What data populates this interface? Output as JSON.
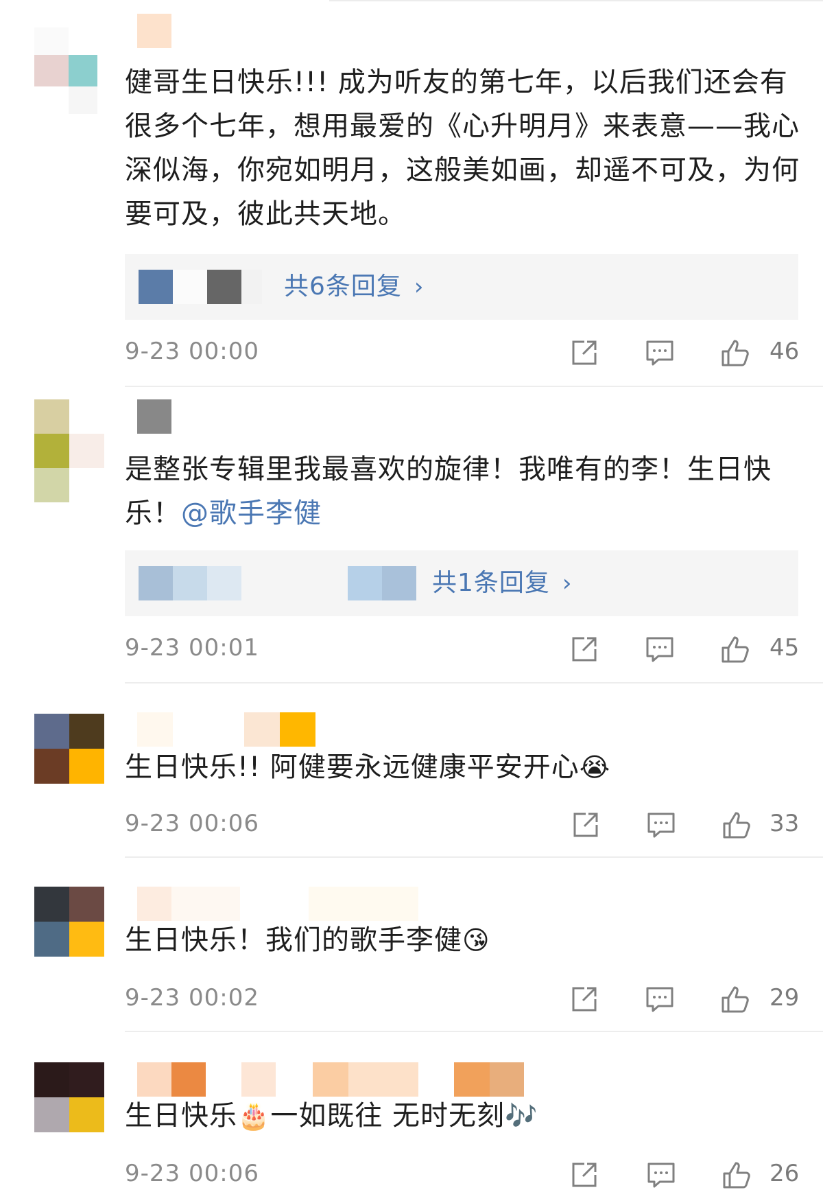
{
  "comments": [
    {
      "text": "健哥生日快乐!!! 成为听友的第七年，以后我们还会有很多个七年，想用最爱的《心升明月》来表意——我心深似海，你宛如明月，这般美如画，却遥不可及，为何要可及，彼此共天地。",
      "replies": "共6条回复",
      "time": "9-23 00:00",
      "likes": "46"
    },
    {
      "text": "是整张专辑里我最喜欢的旋律！我唯有的李！生日快乐！",
      "mention": "@歌手李健",
      "replies": "共1条回复",
      "time": "9-23 00:01",
      "likes": "45"
    },
    {
      "text": "生日快乐!! 阿健要永远健康平安开心",
      "time": "9-23 00:06",
      "likes": "33"
    },
    {
      "text": "生日快乐！我们的歌手李健",
      "time": "9-23 00:02",
      "likes": "29"
    },
    {
      "text": "生日快乐",
      "text_after": "一如既往 无时无刻",
      "time": "9-23 00:06",
      "likes": "26"
    }
  ],
  "icons": {
    "share": "share-icon",
    "comment": "comment-icon",
    "like": "thumbs-up-icon",
    "chevron": "chevron-right-icon"
  },
  "colors": {
    "link": "#4a77b3",
    "meta": "#8a8a8a",
    "reply_bg": "#f5f5f5"
  }
}
